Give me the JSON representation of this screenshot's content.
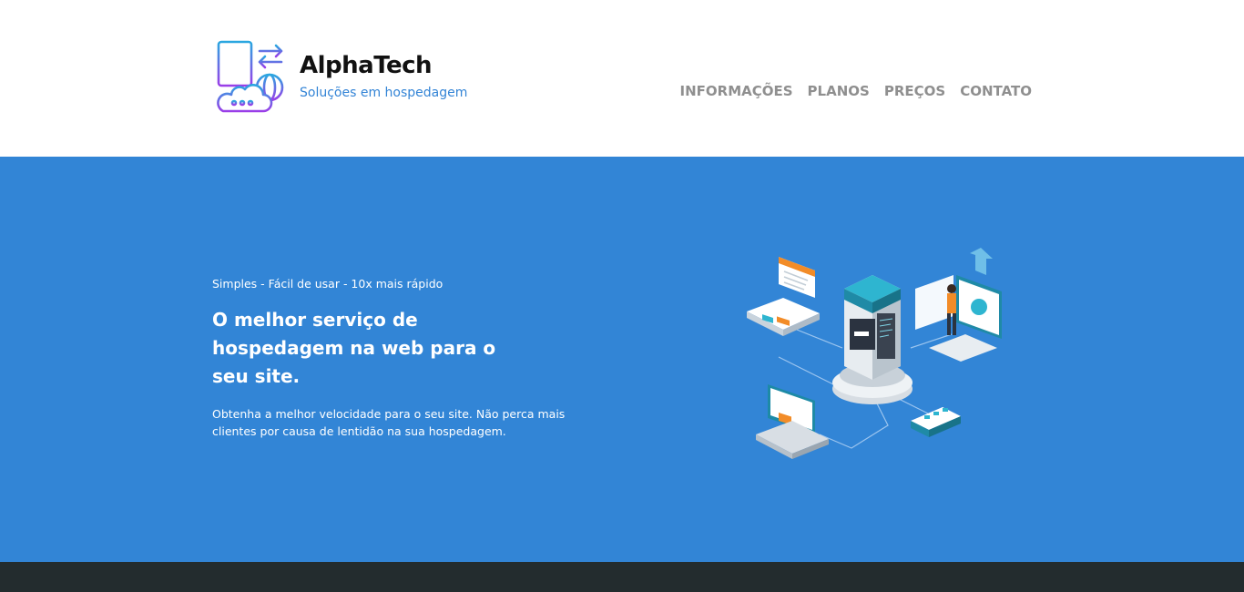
{
  "brand": {
    "title": "AlphaTech",
    "subtitle": "Soluções em hospedagem",
    "logo_icon": "server-cloud-globe-icon"
  },
  "nav": {
    "items": [
      {
        "label": "INFORMAÇÕES"
      },
      {
        "label": "PLANOS"
      },
      {
        "label": "PREÇOS"
      },
      {
        "label": "CONTATO"
      }
    ]
  },
  "hero": {
    "tagline": "Simples - Fácil de usar - 10x mais rápido",
    "headline": "O melhor serviço de hospedagem na web para o seu site.",
    "description": "Obtenha a melhor velocidade para o seu site. Não perca mais clientes por causa de lentidão na sua hospedagem.",
    "illustration_icon": "isometric-server-network-illustration"
  },
  "colors": {
    "accent": "#3285d6",
    "footer": "#232c2e",
    "nav_text": "#8f8f8f",
    "subtitle": "#3384d6"
  }
}
